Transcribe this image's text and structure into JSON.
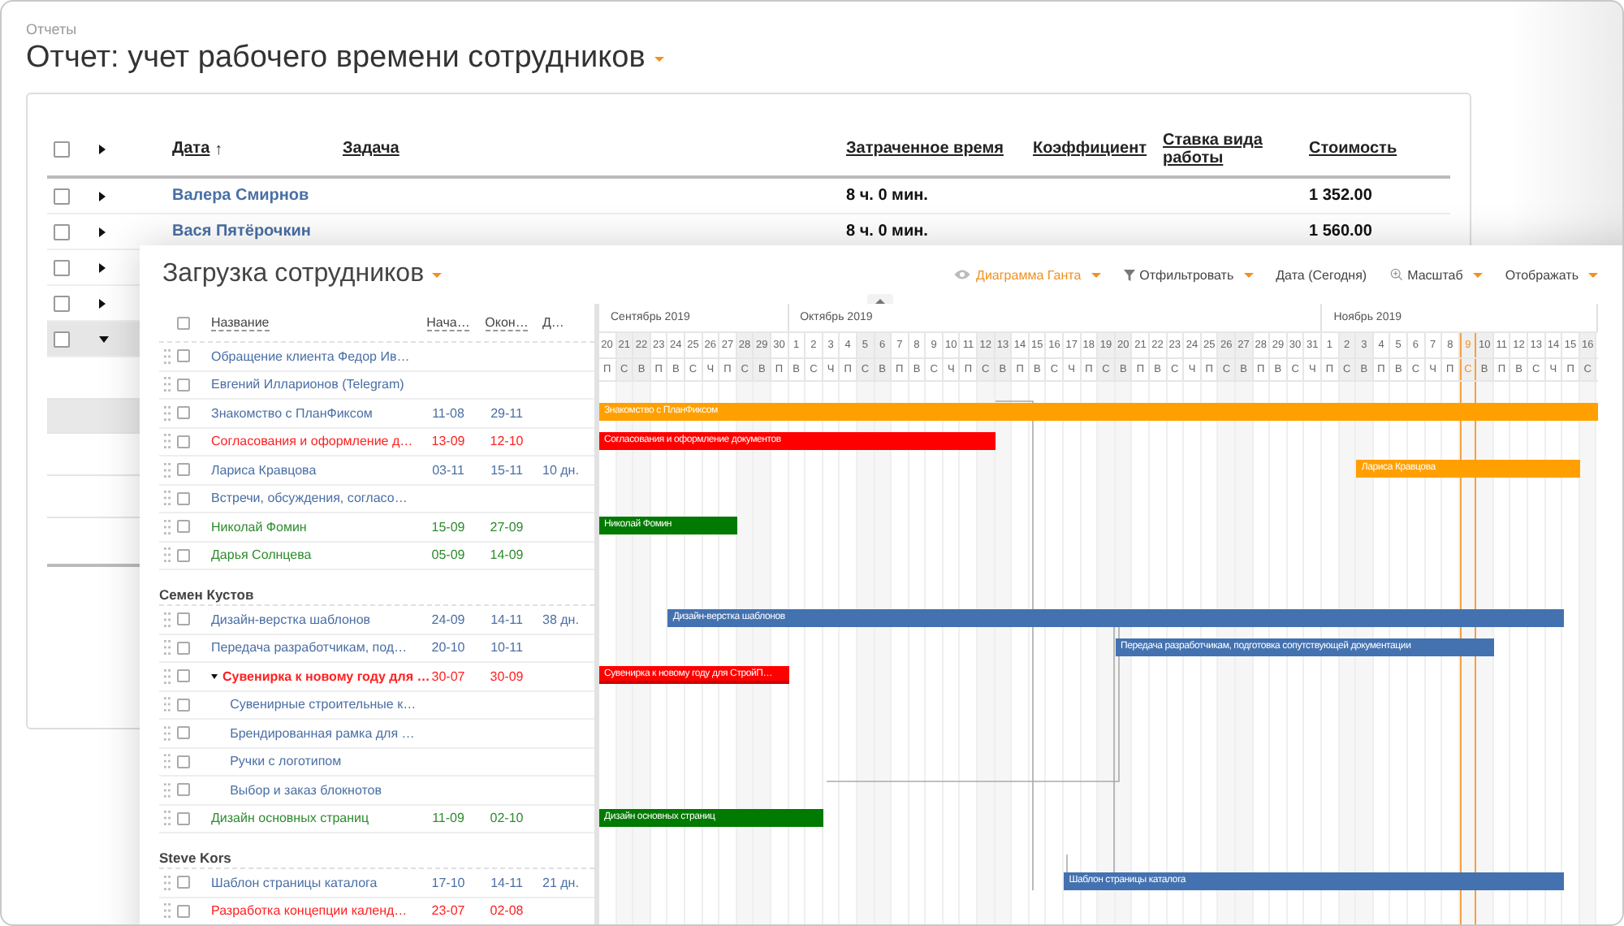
{
  "report": {
    "breadcrumb": "Отчеты",
    "title": "Отчет: учет рабочего времени сотрудников",
    "columns": [
      {
        "label": "Дата",
        "sort_mark": "↑"
      },
      {
        "label": "Задача"
      },
      {
        "label": "Затраченное время"
      },
      {
        "label": "Коэффициент"
      },
      {
        "label": "Ставка вида работы"
      },
      {
        "label": "Стоимость"
      }
    ],
    "all_checked": false,
    "rows": [
      {
        "name": "Валера Смирнов",
        "time": "8 ч. 0 мин.",
        "cost": "1 352.00",
        "expanded": false,
        "selected": false,
        "checked": false
      },
      {
        "name": "Вася Пятёрочкин",
        "time": "8 ч. 0 мин.",
        "cost": "1 560.00",
        "expanded": false,
        "selected": false,
        "checked": false
      },
      {
        "expanded": false,
        "selected": false,
        "checked": false
      },
      {
        "expanded": false,
        "selected": false,
        "checked": false
      },
      {
        "expanded": true,
        "selected": true,
        "checked": false
      }
    ]
  },
  "workload": {
    "title": "Загрузка сотрудников",
    "toolbar": [
      {
        "label": "Диаграмма Ганта",
        "kind": "eye",
        "active": true,
        "caret": true
      },
      {
        "label": "Отфильтровать",
        "kind": "filter",
        "active": false,
        "caret": true
      },
      {
        "label": "Дата (Сегодня)",
        "kind": "plain",
        "active": false,
        "caret": false
      },
      {
        "label": "Масштаб",
        "kind": "zoom",
        "active": false,
        "caret": true
      },
      {
        "label": "Отображать",
        "kind": "plain",
        "active": false,
        "caret": true
      }
    ],
    "all_checked": false,
    "columns": [
      "Название",
      "Нача…",
      "Окон…",
      "Д…"
    ],
    "groups": [
      {
        "rows": [
          {
            "name": "Обращение клиента Федор Ив…",
            "color": "#4a6fa5",
            "checked": false
          },
          {
            "name": "Евгений Илларионов (Telegram)",
            "color": "#4a6fa5",
            "checked": false
          },
          {
            "name": "Знакомство с ПланФиксом",
            "color": "#4a6fa5",
            "checked": false,
            "start": "11-08",
            "end": "29-11",
            "bar": {
              "label": "Знакомство с ПланФиксом",
              "color": "#ffa000"
            }
          },
          {
            "name": "Согласования и оформление д…",
            "color": "#ff2020",
            "checked": false,
            "start": "13-09",
            "end": "12-10",
            "bar": {
              "label": "Согласования и оформление документов",
              "color": "#ff0000"
            }
          },
          {
            "name": "Лариса Кравцова",
            "color": "#4a6fa5",
            "checked": false,
            "start": "03-11",
            "end": "15-11",
            "duration": "10 дн.",
            "bar": {
              "label": "Лариса Кравцова",
              "color": "#ffa000"
            }
          },
          {
            "name": "Встречи, обсуждения, согласо…",
            "color": "#4a6fa5",
            "checked": false
          },
          {
            "name": "Николай Фомин",
            "color": "#2e8b2e",
            "checked": false,
            "start": "15-09",
            "end": "27-09",
            "bar": {
              "label": "Николай Фомин",
              "color": "#007a00"
            }
          },
          {
            "name": "Дарья Солнцева",
            "color": "#2e8b2e",
            "checked": false,
            "start": "05-09",
            "end": "14-09"
          }
        ]
      },
      {
        "name": "Семен Кустов",
        "rows": [
          {
            "name": "Дизайн-верстка шаблонов",
            "color": "#4a6fa5",
            "checked": false,
            "start": "24-09",
            "end": "14-11",
            "duration": "38 дн.",
            "bar": {
              "label": "Дизайн-верстка шаблонов",
              "color": "#4472b0"
            }
          },
          {
            "name": "Передача разработчикам, под…",
            "color": "#4a6fa5",
            "checked": false,
            "start": "20-10",
            "end": "10-11",
            "bar": {
              "label": "Передача разработчикам, подготовка сопутствующей документации",
              "color": "#4472b0"
            }
          },
          {
            "name": "Сувенирка к новому году для …",
            "color": "#ff2020",
            "checked": false,
            "start": "30-07",
            "end": "30-09",
            "expanded": true,
            "bar": {
              "label": "Сувенирка к новому году для СтройП…",
              "color": "#ff0000"
            },
            "children": [
              {
                "name": "Сувенирные строительные к…",
                "color": "#4a6fa5",
                "checked": false
              },
              {
                "name": "Брендированная рамка для …",
                "color": "#4a6fa5",
                "checked": false
              },
              {
                "name": "Ручки с логотипом",
                "color": "#4a6fa5",
                "checked": false
              },
              {
                "name": "Выбор и заказ блокнотов",
                "color": "#4a6fa5",
                "checked": false
              }
            ]
          },
          {
            "name": "Дизайн основных страниц",
            "color": "#2e8b2e",
            "checked": false,
            "start": "11-09",
            "end": "02-10",
            "bar": {
              "label": "Дизайн основных страниц",
              "color": "#007a00"
            }
          }
        ]
      },
      {
        "name": "Steve Kors",
        "rows": [
          {
            "name": "Шаблон страницы каталога",
            "color": "#4a6fa5",
            "checked": false,
            "start": "17-10",
            "end": "14-11",
            "duration": "21 дн.",
            "bar": {
              "label": "Шаблон страницы каталога",
              "color": "#4472b0"
            }
          },
          {
            "name": "Разработка концепции календ…",
            "color": "#ff2020",
            "checked": false,
            "start": "23-07",
            "end": "02-08"
          }
        ]
      }
    ],
    "months": [
      {
        "label": "Сентябрь 2019",
        "days": [
          {
            "n": "20",
            "wd": "П",
            "weekend": false,
            "today": false
          },
          {
            "n": "21",
            "wd": "С",
            "weekend": true,
            "today": false
          },
          {
            "n": "22",
            "wd": "В",
            "weekend": true,
            "today": false
          },
          {
            "n": "23",
            "wd": "П",
            "weekend": false,
            "today": false
          },
          {
            "n": "24",
            "wd": "В",
            "weekend": false,
            "today": false
          },
          {
            "n": "25",
            "wd": "С",
            "weekend": false,
            "today": false
          },
          {
            "n": "26",
            "wd": "Ч",
            "weekend": false,
            "today": false
          },
          {
            "n": "27",
            "wd": "П",
            "weekend": false,
            "today": false
          },
          {
            "n": "28",
            "wd": "С",
            "weekend": true,
            "today": false
          },
          {
            "n": "29",
            "wd": "В",
            "weekend": true,
            "today": false
          },
          {
            "n": "30",
            "wd": "П",
            "weekend": false,
            "today": false
          }
        ]
      },
      {
        "label": "Октябрь 2019",
        "days": [
          {
            "n": "1",
            "wd": "В",
            "weekend": false,
            "today": false
          },
          {
            "n": "2",
            "wd": "С",
            "weekend": false,
            "today": false
          },
          {
            "n": "3",
            "wd": "Ч",
            "weekend": false,
            "today": false
          },
          {
            "n": "4",
            "wd": "П",
            "weekend": false,
            "today": false
          },
          {
            "n": "5",
            "wd": "С",
            "weekend": true,
            "today": false
          },
          {
            "n": "6",
            "wd": "В",
            "weekend": true,
            "today": false
          },
          {
            "n": "7",
            "wd": "П",
            "weekend": false,
            "today": false
          },
          {
            "n": "8",
            "wd": "В",
            "weekend": false,
            "today": false
          },
          {
            "n": "9",
            "wd": "С",
            "weekend": false,
            "today": false
          },
          {
            "n": "10",
            "wd": "Ч",
            "weekend": false,
            "today": false
          },
          {
            "n": "11",
            "wd": "П",
            "weekend": false,
            "today": false
          },
          {
            "n": "12",
            "wd": "С",
            "weekend": true,
            "today": false
          },
          {
            "n": "13",
            "wd": "В",
            "weekend": true,
            "today": false
          },
          {
            "n": "14",
            "wd": "П",
            "weekend": false,
            "today": false
          },
          {
            "n": "15",
            "wd": "В",
            "weekend": false,
            "today": false
          },
          {
            "n": "16",
            "wd": "С",
            "weekend": false,
            "today": false
          },
          {
            "n": "17",
            "wd": "Ч",
            "weekend": false,
            "today": false
          },
          {
            "n": "18",
            "wd": "П",
            "weekend": false,
            "today": false
          },
          {
            "n": "19",
            "wd": "С",
            "weekend": true,
            "today": false
          },
          {
            "n": "20",
            "wd": "В",
            "weekend": true,
            "today": false
          },
          {
            "n": "21",
            "wd": "П",
            "weekend": false,
            "today": false
          },
          {
            "n": "22",
            "wd": "В",
            "weekend": false,
            "today": false
          },
          {
            "n": "23",
            "wd": "С",
            "weekend": false,
            "today": false
          },
          {
            "n": "24",
            "wd": "Ч",
            "weekend": false,
            "today": false
          },
          {
            "n": "25",
            "wd": "П",
            "weekend": false,
            "today": false
          },
          {
            "n": "26",
            "wd": "С",
            "weekend": true,
            "today": false
          },
          {
            "n": "27",
            "wd": "В",
            "weekend": true,
            "today": false
          },
          {
            "n": "28",
            "wd": "П",
            "weekend": false,
            "today": false
          },
          {
            "n": "29",
            "wd": "В",
            "weekend": false,
            "today": false
          },
          {
            "n": "30",
            "wd": "С",
            "weekend": false,
            "today": false
          },
          {
            "n": "31",
            "wd": "Ч",
            "weekend": false,
            "today": false
          }
        ]
      },
      {
        "label": "Ноябрь 2019",
        "days": [
          {
            "n": "1",
            "wd": "П",
            "weekend": false,
            "today": false
          },
          {
            "n": "2",
            "wd": "С",
            "weekend": true,
            "today": false
          },
          {
            "n": "3",
            "wd": "В",
            "weekend": true,
            "today": false
          },
          {
            "n": "4",
            "wd": "П",
            "weekend": false,
            "today": false
          },
          {
            "n": "5",
            "wd": "В",
            "weekend": false,
            "today": false
          },
          {
            "n": "6",
            "wd": "С",
            "weekend": false,
            "today": false
          },
          {
            "n": "7",
            "wd": "Ч",
            "weekend": false,
            "today": false
          },
          {
            "n": "8",
            "wd": "П",
            "weekend": false,
            "today": false
          },
          {
            "n": "9",
            "wd": "С",
            "weekend": true,
            "today": true
          },
          {
            "n": "10",
            "wd": "В",
            "weekend": true,
            "today": false
          },
          {
            "n": "11",
            "wd": "П",
            "weekend": false,
            "today": false
          },
          {
            "n": "12",
            "wd": "В",
            "weekend": false,
            "today": false
          },
          {
            "n": "13",
            "wd": "С",
            "weekend": false,
            "today": false
          },
          {
            "n": "14",
            "wd": "Ч",
            "weekend": false,
            "today": false
          },
          {
            "n": "15",
            "wd": "П",
            "weekend": false,
            "today": false
          },
          {
            "n": "16",
            "wd": "С",
            "weekend": true,
            "today": false
          }
        ]
      }
    ]
  }
}
